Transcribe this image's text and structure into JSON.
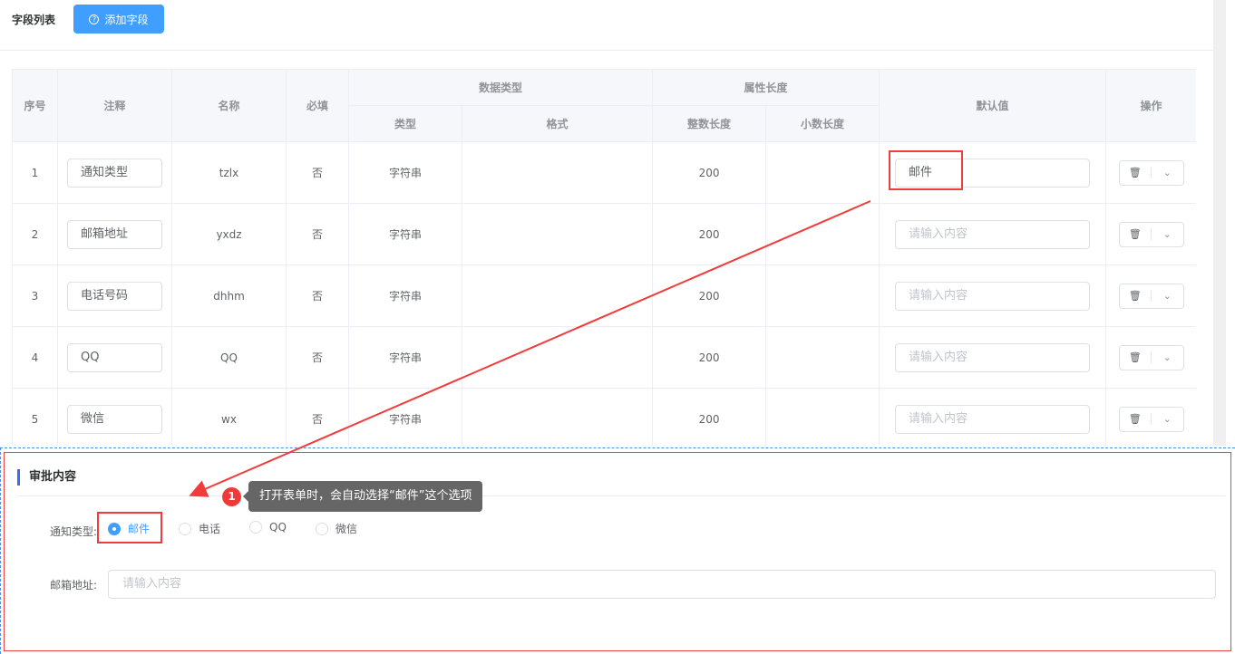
{
  "header": {
    "title": "字段列表",
    "add_button": "添加字段",
    "add_icon": "?"
  },
  "table": {
    "headers": {
      "index": "序号",
      "comment": "注释",
      "name": "名称",
      "required": "必填",
      "data_type": "数据类型",
      "type": "类型",
      "format": "格式",
      "attr_length": "属性长度",
      "int_length": "整数长度",
      "decimal_length": "小数长度",
      "default": "默认值",
      "ops": "操作"
    },
    "placeholder": "请输入内容",
    "rows": [
      {
        "index": "1",
        "comment": "通知类型",
        "name": "tzlx",
        "required": "否",
        "type": "字符串",
        "format": "",
        "int_length": "200",
        "decimal_length": "",
        "default": "邮件"
      },
      {
        "index": "2",
        "comment": "邮箱地址",
        "name": "yxdz",
        "required": "否",
        "type": "字符串",
        "format": "",
        "int_length": "200",
        "decimal_length": "",
        "default": ""
      },
      {
        "index": "3",
        "comment": "电话号码",
        "name": "dhhm",
        "required": "否",
        "type": "字符串",
        "format": "",
        "int_length": "200",
        "decimal_length": "",
        "default": ""
      },
      {
        "index": "4",
        "comment": "QQ",
        "name": "QQ",
        "required": "否",
        "type": "字符串",
        "format": "",
        "int_length": "200",
        "decimal_length": "",
        "default": ""
      },
      {
        "index": "5",
        "comment": "微信",
        "name": "wx",
        "required": "否",
        "type": "字符串",
        "format": "",
        "int_length": "200",
        "decimal_length": "",
        "default": ""
      }
    ]
  },
  "preview": {
    "section_title": "审批内容",
    "notify_label": "通知类型:",
    "options": [
      "邮件",
      "电话",
      "QQ",
      "微信"
    ],
    "selected": "邮件",
    "email_label": "邮箱地址:",
    "email_placeholder": "请输入内容"
  },
  "annotation": {
    "badge": "1",
    "text": "打开表单时，会自动选择“邮件”这个选项",
    "color": "#f23b3b"
  }
}
